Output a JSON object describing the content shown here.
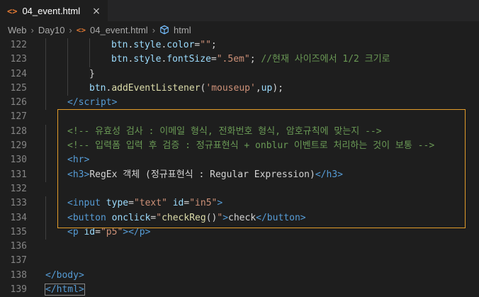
{
  "tab": {
    "icon": "html-file-icon",
    "title": "04_event.html",
    "close": "×"
  },
  "breadcrumb": [
    "Web",
    "Day10",
    "04_event.html",
    "html"
  ],
  "lines": [
    {
      "n": "122",
      "parts": [
        {
          "t": "btn",
          "c": "t-var"
        },
        {
          "t": ".",
          "c": "t-txt"
        },
        {
          "t": "style",
          "c": "t-var"
        },
        {
          "t": ".",
          "c": "t-txt"
        },
        {
          "t": "color",
          "c": "t-var"
        },
        {
          "t": "=",
          "c": "t-txt"
        },
        {
          "t": "\"\"",
          "c": "t-str"
        },
        {
          "t": ";",
          "c": "t-txt"
        }
      ],
      "indent": 3
    },
    {
      "n": "123",
      "parts": [
        {
          "t": "btn",
          "c": "t-var"
        },
        {
          "t": ".",
          "c": "t-txt"
        },
        {
          "t": "style",
          "c": "t-var"
        },
        {
          "t": ".",
          "c": "t-txt"
        },
        {
          "t": "fontSize",
          "c": "t-var"
        },
        {
          "t": "=",
          "c": "t-txt"
        },
        {
          "t": "\".5em\"",
          "c": "t-str"
        },
        {
          "t": "; ",
          "c": "t-txt"
        },
        {
          "t": "//현재 사이즈에서 1/2 크기로",
          "c": "t-com"
        }
      ],
      "indent": 3
    },
    {
      "n": "124",
      "parts": [
        {
          "t": "}",
          "c": "t-txt"
        }
      ],
      "indent": 2
    },
    {
      "n": "125",
      "parts": [
        {
          "t": "btn",
          "c": "t-var"
        },
        {
          "t": ".",
          "c": "t-txt"
        },
        {
          "t": "addEventListener",
          "c": "t-fn"
        },
        {
          "t": "(",
          "c": "t-txt"
        },
        {
          "t": "'mouseup'",
          "c": "t-str"
        },
        {
          "t": ",",
          "c": "t-txt"
        },
        {
          "t": "up",
          "c": "t-var"
        },
        {
          "t": ");",
          "c": "t-txt"
        }
      ],
      "indent": 2
    },
    {
      "n": "126",
      "parts": [
        {
          "t": "</",
          "c": "t-tag"
        },
        {
          "t": "script",
          "c": "t-tag"
        },
        {
          "t": ">",
          "c": "t-tag"
        }
      ],
      "indent": 1
    },
    {
      "n": "127",
      "parts": [],
      "indent": 0
    },
    {
      "n": "128",
      "parts": [
        {
          "t": "<!-- 유효성 검사 : 이메일 형식, 전화번호 형식, 암호규칙에 맞는지 -->",
          "c": "t-com"
        }
      ],
      "indent": 1
    },
    {
      "n": "129",
      "parts": [
        {
          "t": "<!-- 입력폼 입력 후 검증 : 정규표현식 + onblur 이벤트로 처리하는 것이 보통 -->",
          "c": "t-com"
        }
      ],
      "indent": 1
    },
    {
      "n": "130",
      "parts": [
        {
          "t": "<hr>",
          "c": "t-tag"
        }
      ],
      "indent": 1
    },
    {
      "n": "131",
      "parts": [
        {
          "t": "<h3>",
          "c": "t-tag"
        },
        {
          "t": "RegEx 객체 (정규표현식 : Regular Expression)",
          "c": "t-txt"
        },
        {
          "t": "</h3>",
          "c": "t-tag"
        }
      ],
      "indent": 1
    },
    {
      "n": "132",
      "parts": [],
      "indent": 0
    },
    {
      "n": "133",
      "parts": [
        {
          "t": "<input ",
          "c": "t-tag"
        },
        {
          "t": "type",
          "c": "t-var"
        },
        {
          "t": "=",
          "c": "t-txt"
        },
        {
          "t": "\"text\"",
          "c": "t-str"
        },
        {
          "t": " ",
          "c": "t-txt"
        },
        {
          "t": "id",
          "c": "t-var"
        },
        {
          "t": "=",
          "c": "t-txt"
        },
        {
          "t": "\"in5\"",
          "c": "t-str"
        },
        {
          "t": ">",
          "c": "t-tag"
        }
      ],
      "indent": 1
    },
    {
      "n": "134",
      "parts": [
        {
          "t": "<button ",
          "c": "t-tag"
        },
        {
          "t": "onclick",
          "c": "t-var"
        },
        {
          "t": "=",
          "c": "t-txt"
        },
        {
          "t": "\"",
          "c": "t-str"
        },
        {
          "t": "checkReg",
          "c": "t-fn"
        },
        {
          "t": "()",
          "c": "t-txt"
        },
        {
          "t": "\"",
          "c": "t-str"
        },
        {
          "t": ">",
          "c": "t-tag"
        },
        {
          "t": "check",
          "c": "t-txt"
        },
        {
          "t": "</button>",
          "c": "t-tag"
        }
      ],
      "indent": 1
    },
    {
      "n": "135",
      "parts": [
        {
          "t": "<p ",
          "c": "t-tag"
        },
        {
          "t": "id",
          "c": "t-var"
        },
        {
          "t": "=",
          "c": "t-txt"
        },
        {
          "t": "\"p5\"",
          "c": "t-str"
        },
        {
          "t": "></p>",
          "c": "t-tag"
        }
      ],
      "indent": 1
    },
    {
      "n": "136",
      "parts": [],
      "indent": 0
    },
    {
      "n": "137",
      "parts": [],
      "indent": 0
    },
    {
      "n": "138",
      "parts": [
        {
          "t": "</body>",
          "c": "t-tag"
        }
      ],
      "indent": 0
    },
    {
      "n": "139",
      "parts": [
        {
          "t": "</html>",
          "c": "t-tag"
        }
      ],
      "indent": 0
    }
  ],
  "colors": {
    "background": "#1e1e1e",
    "highlight_box": "#e29c2a",
    "tag": "#569cd6",
    "string": "#ce9178",
    "comment": "#6a9955",
    "attribute": "#9cdcfe",
    "function": "#dcdcaa"
  }
}
